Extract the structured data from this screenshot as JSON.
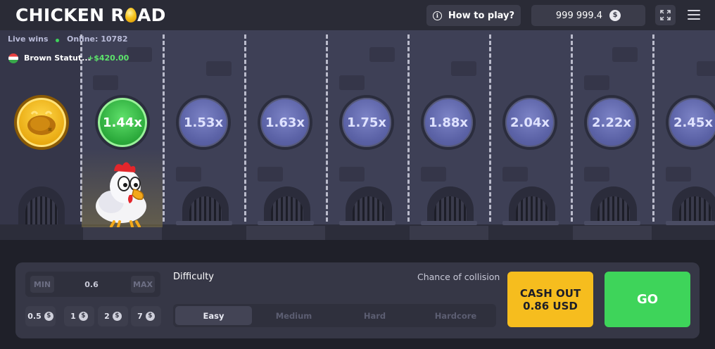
{
  "header": {
    "logo_left": "CHICKEN R",
    "logo_right": "AD",
    "how_to_play": "How to play?",
    "balance": "999 999.4",
    "currency_symbol": "$"
  },
  "live": {
    "label": "Live wins",
    "online": "Online: 10782",
    "latest_win_name": "Brown Statut...",
    "latest_win_amount": "+$420.00"
  },
  "lanes": {
    "multipliers": [
      "1.44x",
      "1.53x",
      "1.63x",
      "1.75x",
      "1.88x",
      "2.04x",
      "2.22x",
      "2.45x"
    ],
    "active_index": 0
  },
  "controls": {
    "min_label": "MIN",
    "max_label": "MAX",
    "bet_value": "0.6",
    "chips": [
      "0.5",
      "1",
      "2",
      "7"
    ],
    "chip_currency": "$",
    "difficulty_label": "Difficulty",
    "collision_label": "Chance of collision",
    "difficulty_options": [
      "Easy",
      "Medium",
      "Hard",
      "Hardcore"
    ],
    "selected_difficulty": "Easy",
    "cashout_line1": "CASH OUT",
    "cashout_line2": "0.86 USD",
    "go_label": "GO"
  },
  "colors": {
    "accent_green": "#3ed45a",
    "cashout_yellow": "#f6bd1e",
    "background": "#1f2029"
  }
}
